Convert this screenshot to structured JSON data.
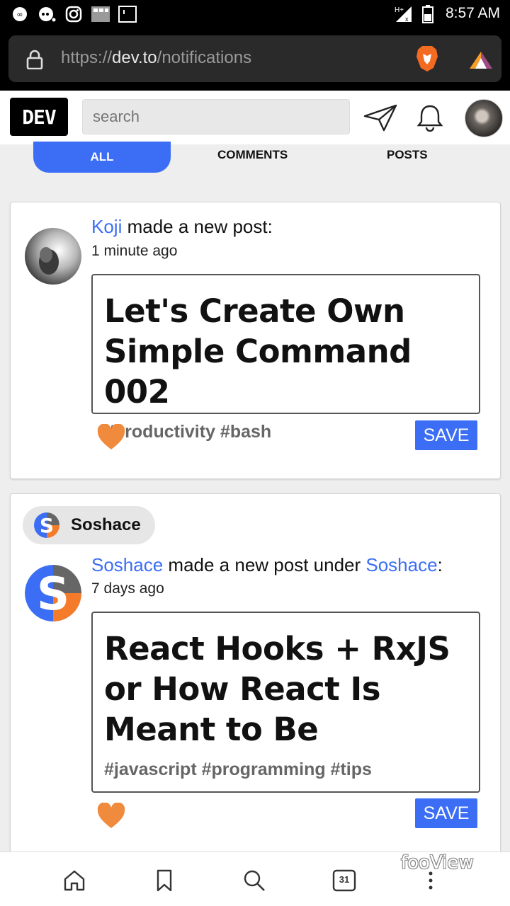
{
  "status_bar": {
    "time": "8:57 AM",
    "icons": [
      "link-icon",
      "chat-icon",
      "instagram-icon",
      "gallery-icon",
      "screen-icon",
      "signal-icon",
      "battery-icon"
    ]
  },
  "browser": {
    "url_scheme": "https://",
    "url_host": "dev.to",
    "url_path": "/notifications"
  },
  "header": {
    "logo": "DEV",
    "search_placeholder": "search"
  },
  "tabs": [
    {
      "label": "ALL",
      "active": true
    },
    {
      "label": "COMMENTS",
      "active": false
    },
    {
      "label": "POSTS",
      "active": false
    }
  ],
  "notifications": [
    {
      "author": "Koji",
      "action": " made a new post:",
      "time_ago": "1 minute ago",
      "post_title": "Let's Create Own Simple Command 002",
      "tags": "#productivity #bash",
      "save_label": "SAVE"
    },
    {
      "org_name": "Soshace",
      "author": "Soshace",
      "action": " made a new post under ",
      "org_link": "Soshace",
      "suffix": ":",
      "time_ago": "7 days ago",
      "post_title": "React Hooks + RxJS or How React Is Meant to Be",
      "tags": "#javascript #programming #tips",
      "save_label": "SAVE"
    }
  ],
  "bottom_nav": {
    "calendar_day": "31",
    "icons": [
      "home-icon",
      "bookmark-icon",
      "search-icon",
      "calendar-icon",
      "more-icon"
    ]
  },
  "watermark": "fooView",
  "colors": {
    "accent": "#3b6ef5",
    "heart": "#f08a3c",
    "dev_logo_bg": "#000000"
  }
}
